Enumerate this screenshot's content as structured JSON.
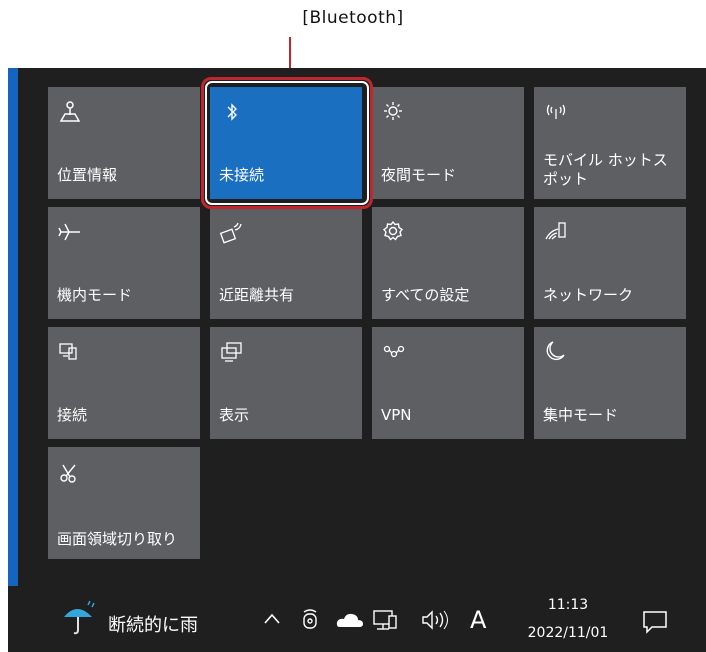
{
  "callout": {
    "label": "[Bluetooth]"
  },
  "tiles": [
    {
      "label": "位置情報",
      "icon": "location-icon",
      "active": false
    },
    {
      "label": "未接続",
      "icon": "bluetooth-icon",
      "active": true
    },
    {
      "label": "夜間モード",
      "icon": "night-light-icon",
      "active": false
    },
    {
      "label": "モバイル ホットスポット",
      "icon": "mobile-hotspot-icon",
      "active": false
    },
    {
      "label": "機内モード",
      "icon": "airplane-icon",
      "active": false
    },
    {
      "label": "近距離共有",
      "icon": "nearby-share-icon",
      "active": false
    },
    {
      "label": "すべての設定",
      "icon": "gear-icon",
      "active": false
    },
    {
      "label": "ネットワーク",
      "icon": "network-icon",
      "active": false
    },
    {
      "label": "接続",
      "icon": "connect-icon",
      "active": false
    },
    {
      "label": "表示",
      "icon": "project-icon",
      "active": false
    },
    {
      "label": "VPN",
      "icon": "vpn-icon",
      "active": false
    },
    {
      "label": "集中モード",
      "icon": "focus-moon-icon",
      "active": false
    },
    {
      "label": "画面領域切り取り",
      "icon": "snip-icon",
      "active": false
    }
  ],
  "taskbar": {
    "weather": "断続的に雨",
    "ime": "A",
    "time": "11:13",
    "date": "2022/11/01"
  },
  "colors": {
    "tile": "#5d5f62",
    "tile_active": "#1b6fc0",
    "panel": "#1f1f1f",
    "accent": "#1565c0",
    "callout": "#c0262d"
  }
}
